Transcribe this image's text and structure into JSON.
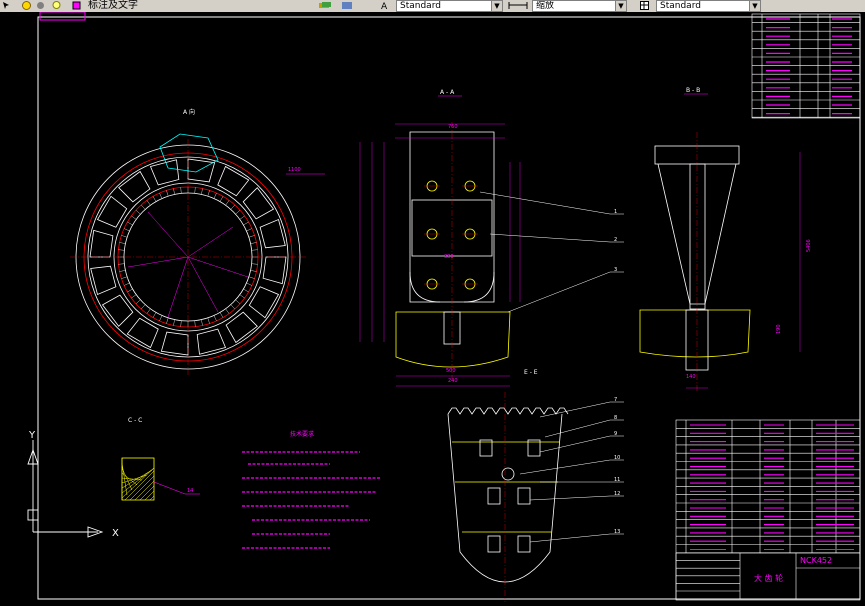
{
  "toolbar": {
    "dim_style_label": "标注及文字",
    "text_style": "Standard",
    "scale_label": "缩放",
    "style_right": "Standard"
  },
  "drawing": {
    "view_a_label": "A 向",
    "section_aa_label": "A - A",
    "section_bb_label": "B - B",
    "section_ee_label": "E - E",
    "section_cc_label": "C - C",
    "tech_title": "技术要求",
    "title_block_code": "NCK452",
    "title_block_name": "大 齿 轮",
    "balloons": [
      "1",
      "2",
      "3",
      "7",
      "8",
      "9",
      "10",
      "11",
      "12",
      "13"
    ],
    "part_no_14": "14",
    "axis_y": "Y",
    "axis_x": "X",
    "dims": {
      "d1": "760",
      "d2": "500",
      "d3": "380",
      "d4": "240",
      "d5": "190",
      "d6": "140",
      "d7": "5406",
      "d8": "1100"
    }
  },
  "colors": {
    "accent": "#ff00ff",
    "line_white": "#ffffff",
    "line_yellow": "#ffff00",
    "line_red": "#ff0000",
    "line_cyan": "#00ffff"
  }
}
